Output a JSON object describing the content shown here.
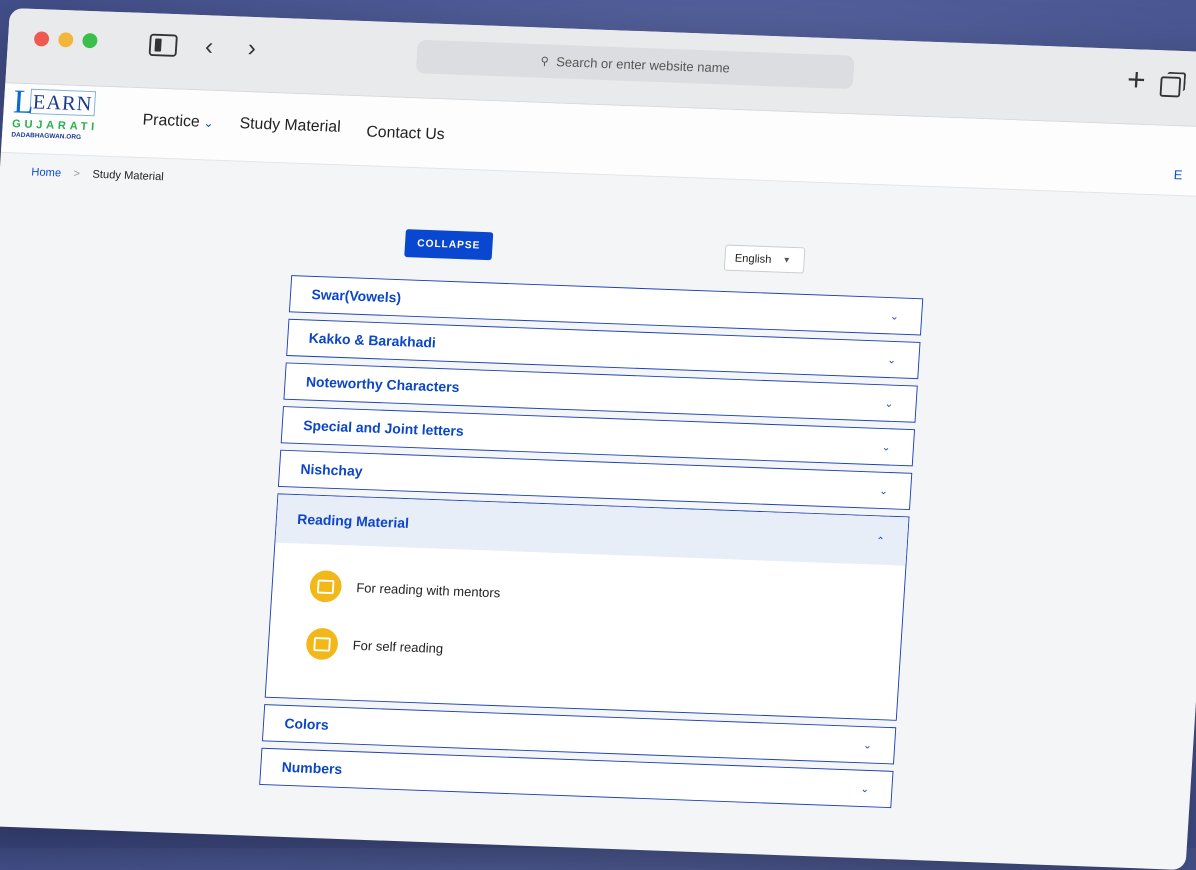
{
  "browser": {
    "url_placeholder": "Search or enter website name"
  },
  "logo": {
    "learn": "EARN",
    "learn_letter": "L",
    "gujarati": "GUJARATI",
    "domain": "DADABHAGWAN.ORG"
  },
  "nav": {
    "practice": "Practice",
    "study_material": "Study Material",
    "contact_us": "Contact Us",
    "lang_short": "E"
  },
  "breadcrumb": {
    "home": "Home",
    "separator": ">",
    "current": "Study Material"
  },
  "controls": {
    "collapse_label": "COLLAPSE",
    "language": "English"
  },
  "accordion": {
    "items_before": [
      "Swar(Vowels)",
      "Kakko & Barakhadi",
      "Noteworthy Characters",
      "Special and Joint letters",
      "Nishchay"
    ],
    "open_section": {
      "title": "Reading Material",
      "links": [
        "For reading with mentors",
        "For self reading"
      ]
    },
    "items_after": [
      "Colors",
      "Numbers"
    ]
  },
  "colors": {
    "accent": "#0b46c8",
    "button": "#0a47d0",
    "icon_bg": "#f2b81a"
  }
}
